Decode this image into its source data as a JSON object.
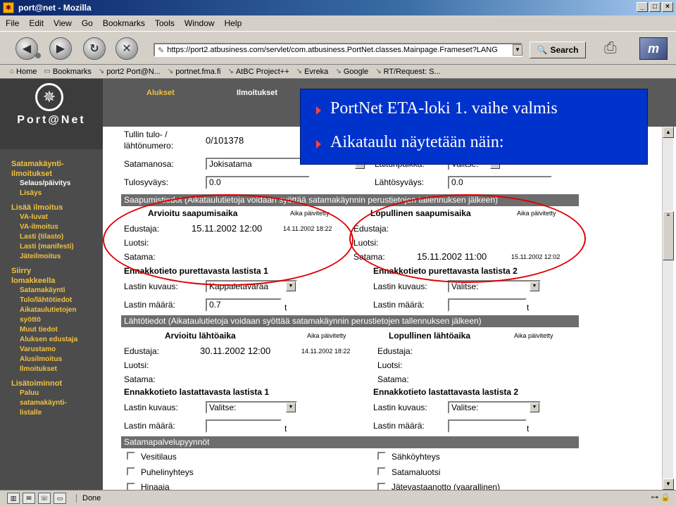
{
  "window": {
    "title": "port@net - Mozilla"
  },
  "menu": [
    "File",
    "Edit",
    "View",
    "Go",
    "Bookmarks",
    "Tools",
    "Window",
    "Help"
  ],
  "nav": {
    "url": "https://port2.atbusiness.com/servlet/com.atbusiness.PortNet.classes.Mainpage.Frameset?LANG",
    "search_label": "Search"
  },
  "bookmarks": [
    "Home",
    "Bookmarks",
    "port2 Port@N...",
    "portnet.fma.fi",
    "AtBC Project++",
    "Evreka",
    "Google",
    "RT/Request: S..."
  ],
  "brand": "Port@Net",
  "topnav": {
    "tabs": [
      "Alukset",
      "Ilmoitukset"
    ]
  },
  "leftnav": [
    {
      "text": "Satamakäynti-",
      "kind": "sect"
    },
    {
      "text": "ilmoitukset",
      "kind": "sect2"
    },
    {
      "text": "Selaus/päivitys",
      "kind": "active"
    },
    {
      "text": "Lisäys",
      "kind": "item"
    },
    {
      "text": "Lisää ilmoitus",
      "kind": "sect"
    },
    {
      "text": "VA-luvat",
      "kind": "sub"
    },
    {
      "text": "VA-ilmoitus",
      "kind": "sub"
    },
    {
      "text": "Lasti (tilasto)",
      "kind": "sub"
    },
    {
      "text": "Lasti (manifesti)",
      "kind": "sub"
    },
    {
      "text": "Jäteilmoitus",
      "kind": "sub"
    },
    {
      "text": "Siirry",
      "kind": "sect"
    },
    {
      "text": "lomakkeella",
      "kind": "sect2"
    },
    {
      "text": "Satamakäynti",
      "kind": "sub"
    },
    {
      "text": "Tulo/lähtötiedot",
      "kind": "sub"
    },
    {
      "text": "Aikataulutietojen",
      "kind": "sub"
    },
    {
      "text": "syöttö",
      "kind": "sub"
    },
    {
      "text": "Muut tiedot",
      "kind": "sub"
    },
    {
      "text": "Aluksen edustaja",
      "kind": "sub"
    },
    {
      "text": "Varustamo",
      "kind": "sub"
    },
    {
      "text": "Alusilmoitus",
      "kind": "sub"
    },
    {
      "text": "Ilmoitukset",
      "kind": "sub"
    },
    {
      "text": "Lisätoiminnot",
      "kind": "sect"
    },
    {
      "text": "Paluu",
      "kind": "sub"
    },
    {
      "text": "satamakäynti-",
      "kind": "sub"
    },
    {
      "text": "listalle",
      "kind": "sub"
    }
  ],
  "form": {
    "ref_label_1": "Tullin tulo- /",
    "ref_label_2": "lähtönumero:",
    "ref_value": "0/101378",
    "harbour_label": "Satamanosa:",
    "harbour_value": "Jokisatama",
    "berth_label": "Laituripaikka:",
    "berth_value": "Valitse:",
    "arr_draught_label": "Tulosyväys:",
    "arr_draught_value": "0.0",
    "dep_draught_label": "Lähtösyväys:",
    "dep_draught_value": "0.0",
    "arrival_bar": "Saapumistiedot (Aikataulutietoja voidaan syöttää satamakäynnin perustietojen tallennuksen jälkeen)",
    "est_arrival": "Arvioitu saapumisaika",
    "final_arrival": "Lopullinen saapumisaika",
    "updated": "Aika päivitetty",
    "agent": "Edustaja:",
    "pilot": "Luotsi:",
    "port": "Satama:",
    "est_arr_agent_time": "15.11.2002 12:00",
    "est_arr_agent_upd": "14.11.2002 18:22",
    "final_arr_port_time": "15.11.2002 11:00",
    "final_arr_port_upd": "15.11.2002 12:02",
    "unload_1": "Ennakkotieto purettavasta lastista 1",
    "unload_2": "Ennakkotieto purettavasta lastista 2",
    "cargo_desc": "Lastin kuvaus:",
    "cargo_qty": "Lastin määrä:",
    "unload_1_desc": "Kappaletavaraa",
    "unload_1_qty": "0.7",
    "unload_2_desc": "Valitse:",
    "unit_t": "t",
    "departure_bar": "Lähtötiedot (Aikataulutietoja voidaan syöttää satamakäynnin perustietojen tallennuksen jälkeen)",
    "est_departure": "Arvioitu lähtöaika",
    "final_departure": "Lopullinen lähtöaika",
    "est_dep_agent_time": "30.11.2002 12:00",
    "est_dep_agent_upd": "14.11.2002 18:22",
    "load_1": "Ennakkotieto lastattavasta lastista 1",
    "load_2": "Ennakkotieto lastattavasta lastista 2",
    "load_1_desc": "Valitse:",
    "load_2_desc": "Valitse:",
    "services_bar": "Satamapalvelupyynnöt",
    "services": {
      "water": "Vesitilaus",
      "electricity": "Sähköyhteys",
      "phone": "Puhelinyhteys",
      "harbour_pilot": "Satamaluotsi",
      "hinaaja": "Hinaaja",
      "waste": "Jätevastaanotto (vaarallinen)"
    }
  },
  "callout": {
    "line1": "PortNet ETA-loki 1. vaihe valmis",
    "line2": "Aikataulu näytetään näin:"
  },
  "status": {
    "text": "Done"
  },
  "colors": {
    "accent": "#0033cc",
    "nav_text": "#f0c040",
    "highlight": "#e00000"
  }
}
